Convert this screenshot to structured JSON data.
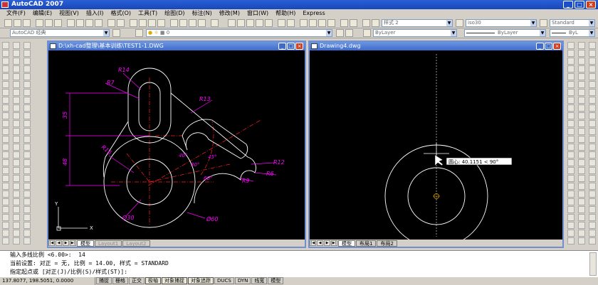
{
  "app": {
    "title": "AutoCAD 2007"
  },
  "menu": [
    "文件(F)",
    "编辑(E)",
    "视图(V)",
    "插入(I)",
    "格式(O)",
    "工具(T)",
    "绘图(D)",
    "标注(N)",
    "修改(M)",
    "窗口(W)",
    "帮助(H)",
    "Express"
  ],
  "toolbar": {
    "workspace": "AutoCAD 经典",
    "text_style": "样式 2",
    "dim_style": "iso30",
    "table_style": "Standard",
    "layer": "0",
    "color": "ByLayer",
    "linetype": "ByLayer",
    "lineweight": "ByL"
  },
  "windows": {
    "left": {
      "title": "D:\\xh-cad整理\\基本训练\\TEST1-1.DWG",
      "tabs": [
        "模型",
        "Layout1",
        "Layout2"
      ]
    },
    "right": {
      "title": "Drawing4.dwg",
      "tabs": [
        "模型",
        "布局1",
        "布局2"
      ],
      "tooltip": "圆心: 40.1151 < 90°"
    }
  },
  "drawing": {
    "dims": [
      "R14",
      "R7",
      "R13",
      "35",
      "48",
      "R16",
      "R12",
      "R6",
      "R9",
      "Ø30",
      "Ø60",
      "40°",
      "30°",
      "45°",
      "60°"
    ],
    "axis_y": "Y",
    "axis_x": "X"
  },
  "command": {
    "lines": [
      "输入多线比例 <6.00>:  14",
      "当前设置: 对正 = 无, 比例 = 14.00, 样式 = STANDARD",
      "指定起点或 [对正(J)/比例(S)/样式(ST)]:"
    ]
  },
  "status": {
    "coords": "137.8077, 198.5051, 0.0000",
    "buttons": [
      "捕捉",
      "栅格",
      "正交",
      "极轴",
      "对象捕捉",
      "对象追踪",
      "DUCS",
      "DYN",
      "线宽",
      "模型"
    ]
  },
  "colors": {
    "magenta": "#ff00ff",
    "red": "#ff2020",
    "white": "#ffffff",
    "titlebar": "#1848b8"
  }
}
